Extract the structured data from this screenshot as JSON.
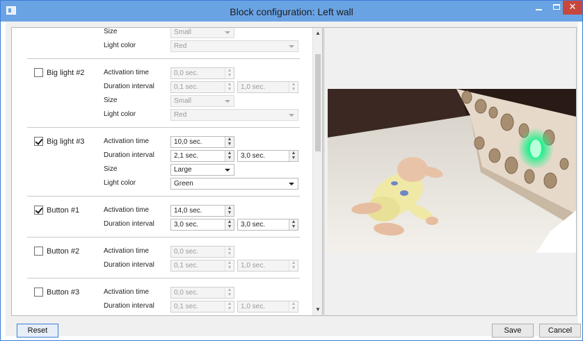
{
  "window": {
    "title": "Block configuration: Left wall",
    "minimize_symbol": "–",
    "close_symbol": "✕"
  },
  "settings": [
    {
      "name": "",
      "checked": false,
      "disabled": true,
      "partial": true,
      "rows": [
        {
          "label": "Size",
          "kind": "combo-small",
          "value": "Small"
        },
        {
          "label": "Light color",
          "kind": "combo-wide",
          "value": "Red"
        }
      ]
    },
    {
      "name": "Big light #2",
      "checked": false,
      "disabled": true,
      "rows": [
        {
          "label": "Activation time",
          "kind": "spin1",
          "value": "0,0 sec."
        },
        {
          "label": "Duration interval",
          "kind": "spin2",
          "value": "0,1 sec.",
          "value2": "1,0 sec."
        },
        {
          "label": "Size",
          "kind": "combo-small",
          "value": "Small"
        },
        {
          "label": "Light color",
          "kind": "combo-wide",
          "value": "Red"
        }
      ]
    },
    {
      "name": "Big light #3",
      "checked": true,
      "disabled": false,
      "rows": [
        {
          "label": "Activation time",
          "kind": "spin1",
          "value": "10,0 sec."
        },
        {
          "label": "Duration interval",
          "kind": "spin2",
          "value": "2,1 sec.",
          "value2": "3,0 sec."
        },
        {
          "label": "Size",
          "kind": "combo-small",
          "value": "Large"
        },
        {
          "label": "Light color",
          "kind": "combo-wide",
          "value": "Green"
        }
      ]
    },
    {
      "name": "Button #1",
      "checked": true,
      "disabled": false,
      "rows": [
        {
          "label": "Activation time",
          "kind": "spin1",
          "value": "14,0 sec."
        },
        {
          "label": "Duration interval",
          "kind": "spin2",
          "value": "3,0 sec.",
          "value2": "3,0 sec."
        }
      ]
    },
    {
      "name": "Button #2",
      "checked": false,
      "disabled": true,
      "rows": [
        {
          "label": "Activation time",
          "kind": "spin1",
          "value": "0,0 sec."
        },
        {
          "label": "Duration interval",
          "kind": "spin2",
          "value": "0,1 sec.",
          "value2": "1,0 sec."
        }
      ]
    },
    {
      "name": "Button #3",
      "checked": false,
      "disabled": true,
      "rows": [
        {
          "label": "Activation time",
          "kind": "spin1",
          "value": "0,0 sec."
        },
        {
          "label": "Duration interval",
          "kind": "spin2",
          "value": "0,1 sec.",
          "value2": "1,0 sec."
        }
      ]
    }
  ],
  "scrollbar": {
    "up_icon": "chevron-up-icon",
    "down_icon": "chevron-down-icon"
  },
  "preview": {
    "image": "camera-preview-baby-in-box",
    "glow_color": "#1cf08a"
  },
  "footer": {
    "reset_label": "Reset",
    "save_label": "Save",
    "cancel_label": "Cancel"
  },
  "colors": {
    "titlebar": "#6aa3e4",
    "close_button": "#c7473c",
    "window_border": "#3a7cd8"
  }
}
